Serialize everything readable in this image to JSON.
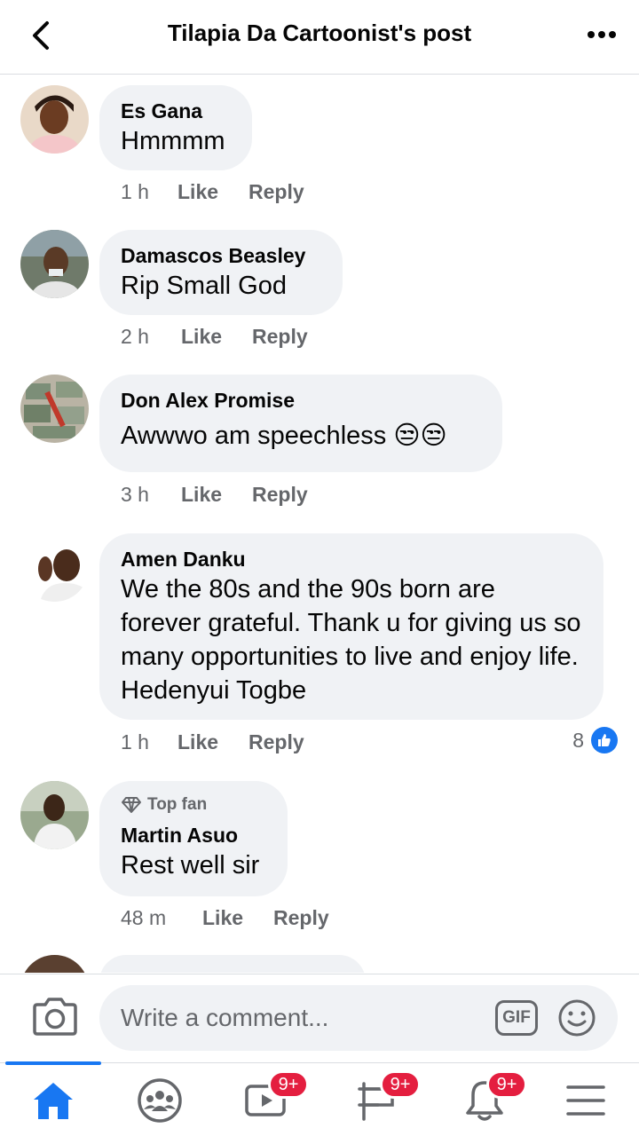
{
  "header": {
    "title": "Tilapia Da Cartoonist's post"
  },
  "comments": [
    {
      "author": "Es Gana",
      "text": "Hmmmm",
      "time": "1 h",
      "like": "Like",
      "reply": "Reply"
    },
    {
      "author": "Damascos Beasley",
      "text": "Rip Small God",
      "time": "2 h",
      "like": "Like",
      "reply": "Reply"
    },
    {
      "author": "Don Alex Promise",
      "text": "Awwwo am speechless 😒😒",
      "time": "3 h",
      "like": "Like",
      "reply": "Reply"
    },
    {
      "author": "Amen Danku",
      "text": "We the 80s and the 90s born are forever grateful. Thank u for giving us so many opportunities to live and enjoy life. Hedenyui Togbe",
      "time": "1 h",
      "like": "Like",
      "reply": "Reply",
      "reactions": "8"
    },
    {
      "badge": "Top fan",
      "author": "Martin Asuo",
      "text": "Rest well sir",
      "time": "48 m",
      "like": "Like",
      "reply": "Reply"
    }
  ],
  "composer": {
    "placeholder": "Write a comment...",
    "gif": "GIF"
  },
  "nav": {
    "watch_badge": "9+",
    "feeds_badge": "9+",
    "notifications_badge": "9+"
  },
  "colors": {
    "accent": "#1877f2",
    "badge": "#e41e3f",
    "bubble": "#f0f2f5",
    "meta": "#65676b"
  }
}
